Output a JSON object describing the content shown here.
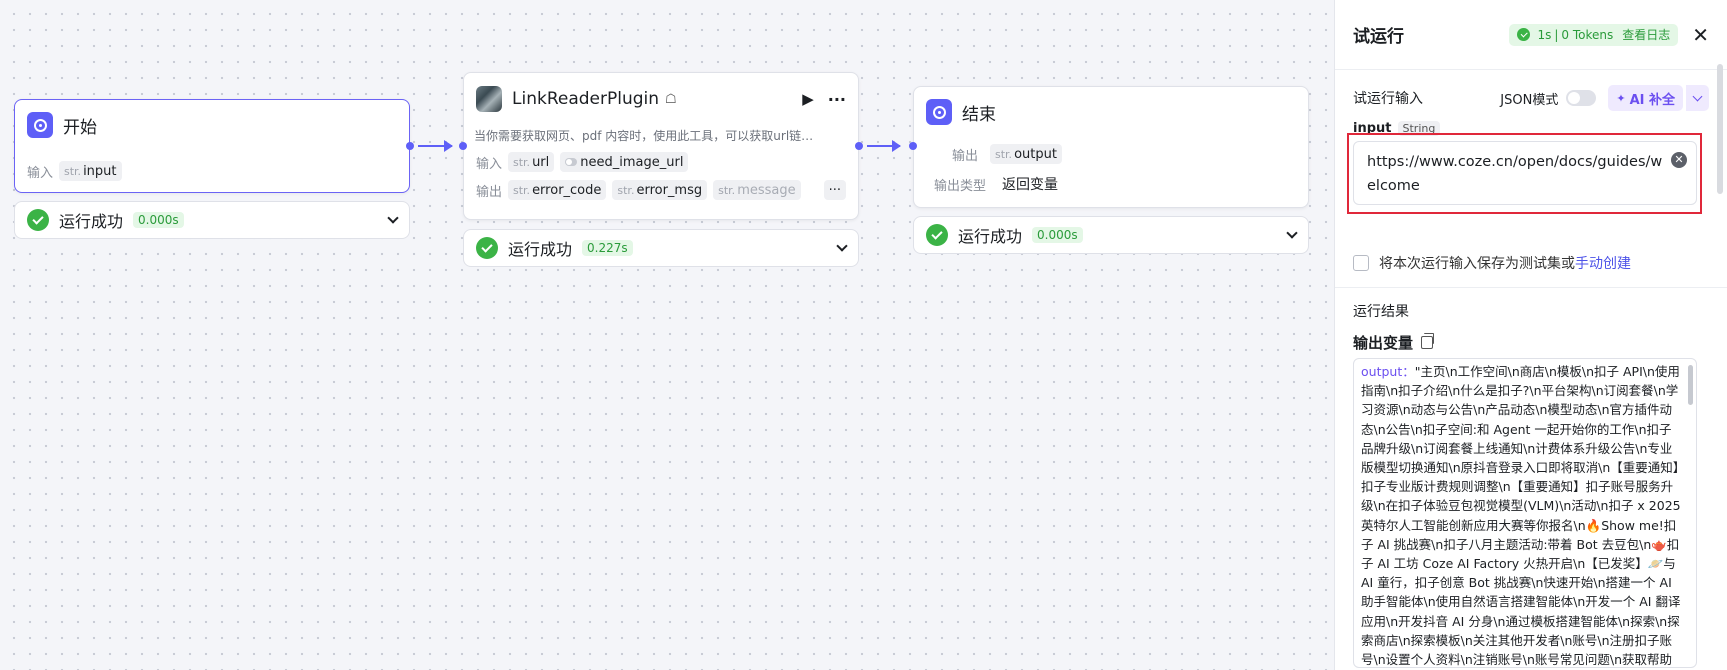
{
  "colors": {
    "accent": "#5e5ff7",
    "success": "#3bb346",
    "ai": "#6b4ff0",
    "alert": "#e0283a"
  },
  "nodes": {
    "start": {
      "title": "开始",
      "input_label": "输入",
      "input_type": "str.",
      "input_name": "input",
      "status": "运行成功",
      "time": "0.000s"
    },
    "plugin": {
      "title": "LinkReaderPlugin",
      "description": "当你需要获取网页、pdf 内容时，使用此工具，可以获取url链…",
      "input_label": "输入",
      "inputs": [
        {
          "type": "str.",
          "name": "url"
        },
        {
          "type": "",
          "name": "need_image_url"
        }
      ],
      "output_label": "输出",
      "outputs": [
        {
          "type": "str.",
          "name": "error_code"
        },
        {
          "type": "str.",
          "name": "error_msg"
        },
        {
          "type": "str.",
          "name": "message"
        }
      ],
      "more": "···",
      "status": "运行成功",
      "time": "0.227s"
    },
    "end": {
      "title": "结束",
      "output_label": "输出",
      "output_type": "str.",
      "output_name": "output",
      "output_kind_label": "输出类型",
      "output_kind": "返回变量",
      "status": "运行成功",
      "time": "0.000s"
    }
  },
  "panel": {
    "title": "试运行",
    "duration": "1s",
    "tokens": "0 Tokens",
    "log_link": "查看日志",
    "input_section": "试运行输入",
    "json_mode": "JSON模式",
    "ai_button": "AI 补全",
    "input_name": "input",
    "input_type": "String",
    "input_value": "https://www.coze.cn/open/docs/guides/welcome",
    "save_text": "将本次运行输入保存为测试集或",
    "save_link": "手动创建",
    "result_section": "运行结果",
    "output_vars": "输出变量",
    "output_key": "output",
    "output_value": "\"主页\\n工作空间\\n商店\\n模板\\n扣子 API\\n使用指南\\n扣子介绍\\n什么是扣子?\\n平台架构\\n订阅套餐\\n学习资源\\n动态与公告\\n产品动态\\n模型动态\\n官方插件动态\\n公告\\n扣子空间:和 Agent 一起开始你的工作\\n扣子品牌升级\\n订阅套餐上线通知\\n计费体系升级公告\\n专业版模型切换通知\\n原抖音登录入口即将取消\\n【重要通知】扣子专业版计费规则调整\\n【重要通知】扣子账号服务升级\\n在扣子体验豆包视觉模型(VLM)\\n活动\\n扣子 x 2025英特尔人工智能创新应用大赛等你报名\\n🔥Show me!扣子 AI 挑战赛\\n扣子八月主题活动:带着 Bot 去豆包\\n🫖扣子 AI 工坊 Coze AI Factory 火热开启\\n【已发奖】🪐与 AI 童行，扣子创意 Bot 挑战赛\\n快速开始\\n搭建一个 AI 助手智能体\\n使用自然语言搭建智能体\\n开发一个 AI 翻译应用\\n开发抖音 AI 分身\\n通过模板搭建智能体\\n探索\\n探索商店\\n探索模板\\n关注其他开发者\\n账号\\n注册扣子账号\\n设置个人资料\\n注销账号\\n账号常见问题\\n获取帮助"
  }
}
